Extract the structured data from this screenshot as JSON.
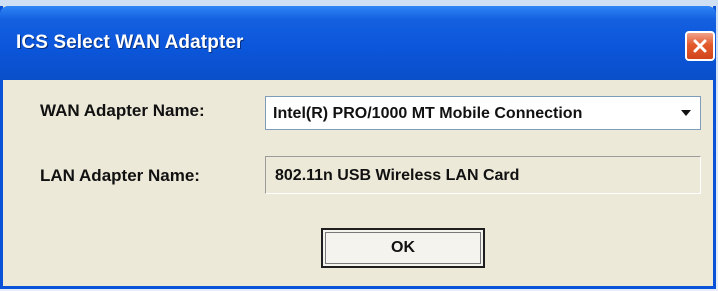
{
  "window": {
    "title": "ICS Select WAN Adatpter",
    "close_icon": "close-icon"
  },
  "wan": {
    "label": "WAN Adapter Name:",
    "selected_value": "Intel(R) PRO/1000 MT Mobile Connection",
    "dropdown_icon": "chevron-down-icon"
  },
  "lan": {
    "label": "LAN Adapter Name:",
    "value": "802.11n USB Wireless LAN Card"
  },
  "buttons": {
    "ok_label": "OK"
  },
  "colors": {
    "titlebar": "#0b56db",
    "dialog_bg": "#ece9d8",
    "close_button": "#e35b2c"
  }
}
